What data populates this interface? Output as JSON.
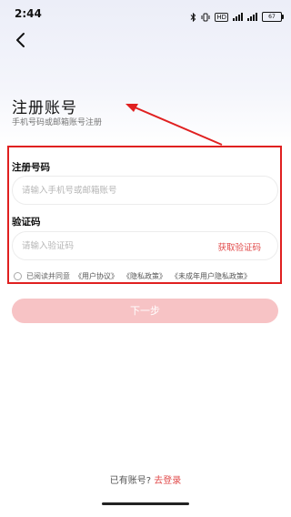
{
  "status_bar": {
    "time": "2:44",
    "hd_label": "HD",
    "battery": "67"
  },
  "header": {
    "back_icon": "chevron-left-icon",
    "title": "注册账号",
    "subtitle": "手机号码或邮箱账号注册"
  },
  "form": {
    "phone_label": "注册号码",
    "phone_placeholder": "请输入手机号或邮箱账号",
    "code_label": "验证码",
    "code_placeholder": "请输入验证码",
    "get_code": "获取验证码"
  },
  "agreement": {
    "prefix": "已阅读并同意",
    "user_agreement": "《用户协议》",
    "privacy_policy": "《隐私政策》",
    "minor_privacy_policy": "《未成年用户隐私政策》"
  },
  "next_button": "下一步",
  "footer": {
    "prompt": "已有账号?",
    "login_link": "去登录"
  },
  "colors": {
    "accent": "#e14a4a",
    "button_disabled": "#f7c3c5",
    "annotation": "#e02020"
  }
}
